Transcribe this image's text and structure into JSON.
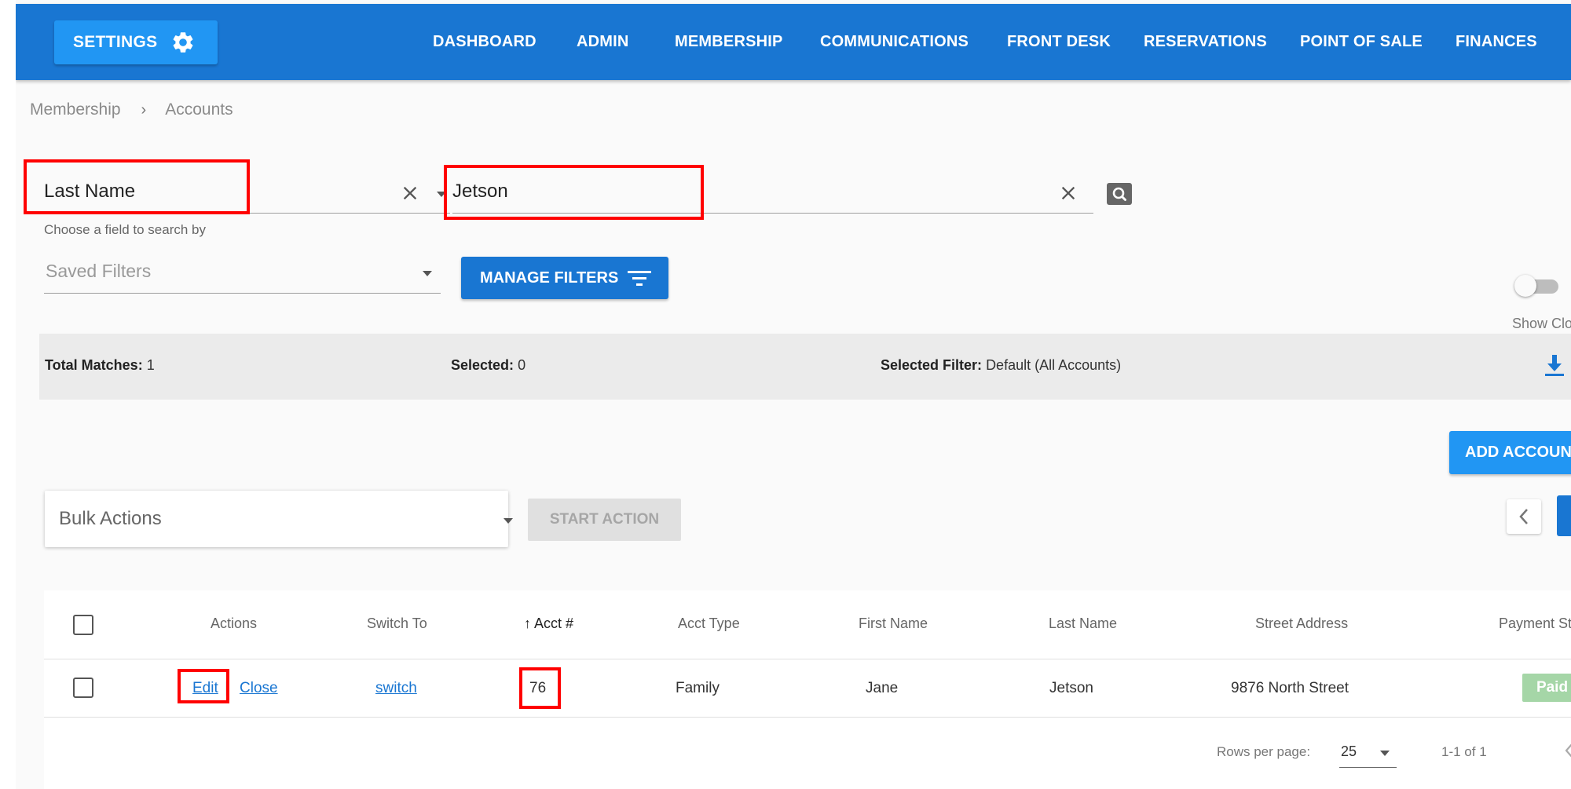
{
  "nav": {
    "settings_label": "SETTINGS",
    "links": [
      "DASHBOARD",
      "ADMIN",
      "MEMBERSHIP",
      "COMMUNICATIONS",
      "FRONT DESK",
      "RESERVATIONS",
      "POINT OF SALE",
      "FINANCES"
    ]
  },
  "breadcrumb": {
    "items": [
      "Membership",
      "Accounts"
    ],
    "separator": "›"
  },
  "search": {
    "field_value": "Last Name",
    "field_hint": "Choose a field to search by",
    "query_value": "Jetson"
  },
  "filters": {
    "saved_placeholder": "Saved Filters",
    "manage_label": "MANAGE FILTERS"
  },
  "toggle": {
    "label": "Show Clo",
    "on": false
  },
  "info": {
    "total_label": "Total Matches:",
    "total_value": "1",
    "selected_label": "Selected:",
    "selected_value": "0",
    "filter_label": "Selected Filter:",
    "filter_value": "Default (All Accounts)"
  },
  "actions": {
    "add_label": "ADD ACCOUN",
    "bulk_placeholder": "Bulk Actions",
    "start_label": "START ACTION"
  },
  "table": {
    "headers": [
      "Actions",
      "Switch To",
      "Acct #",
      "Acct Type",
      "First Name",
      "Last Name",
      "Street Address",
      "Payment St"
    ],
    "sort_indicator": "↑",
    "rows": [
      {
        "edit": "Edit",
        "divider": "|",
        "close": "Close",
        "switch": "switch",
        "acct": "76",
        "type": "Family",
        "first": "Jane",
        "last": "Jetson",
        "address": "9876 North Street",
        "payment_status": "Paid"
      }
    ],
    "footer": {
      "rows_per_page_label": "Rows per page:",
      "rows_per_page_value": "25",
      "range": "1-1 of 1"
    }
  },
  "colors": {
    "primary": "#1976d2",
    "accent": "#2196f3",
    "annotation": "#ff0000",
    "paid_badge": "#a5d6a7"
  }
}
